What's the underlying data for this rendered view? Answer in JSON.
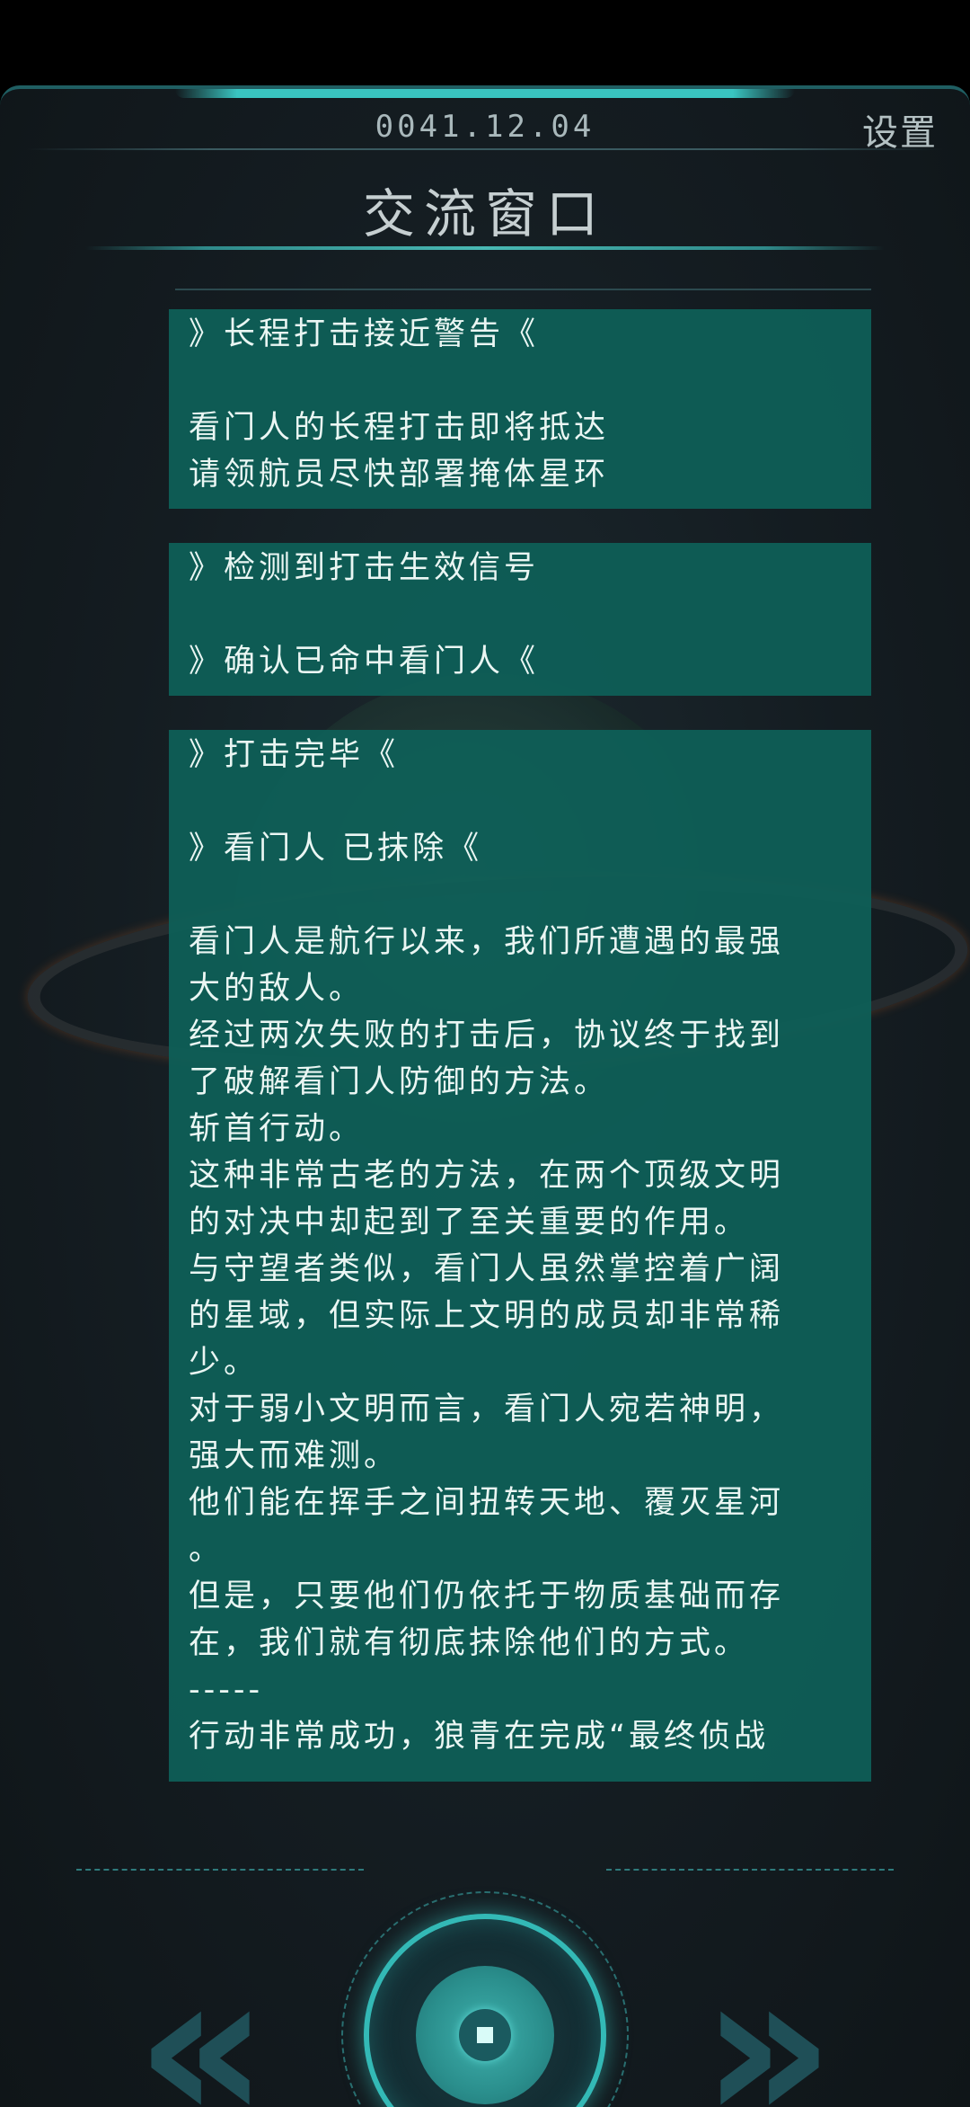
{
  "header": {
    "date": "0041.12.04",
    "settings_label": "设置",
    "title": "交流窗口"
  },
  "messages": {
    "card1": {
      "line1": "》长程打击接近警告《",
      "line2": "看门人的长程打击即将抵达",
      "line3": "请领航员尽快部署掩体星环"
    },
    "card2": {
      "line1": "》检测到打击生效信号",
      "line2": "》确认已命中看门人《"
    },
    "card3": {
      "line1": "》打击完毕《",
      "line2": "》看门人 已抹除《",
      "body": [
        "看门人是航行以来，我们所遭遇的最强",
        "大的敌人。",
        "经过两次失败的打击后，协议终于找到",
        "了破解看门人防御的方法。",
        "斩首行动。",
        "这种非常古老的方法，在两个顶级文明",
        "的对决中却起到了至关重要的作用。",
        "与守望者类似，看门人虽然掌控着广阔",
        "的星域，但实际上文明的成员却非常稀",
        "少。",
        "对于弱小文明而言，看门人宛若神明，",
        "强大而难测。",
        "他们能在挥手之间扭转天地、覆灭星河",
        "。",
        "但是，只要他们仍依托于物质基础而存",
        "在，我们就有彻底抹除他们的方式。",
        "-----",
        "行动非常成功，狼青在完成“最终侦战"
      ]
    }
  },
  "controls": {
    "prev_icon": "double-chevron-left-icon",
    "next_icon": "double-chevron-right-icon",
    "center_icon": "stop-square-icon",
    "prev_glyph": "«",
    "next_glyph": "»"
  },
  "colors": {
    "card_bg": "#0e6058",
    "accent": "#33b9b6",
    "arrow": "#1f4f57"
  }
}
